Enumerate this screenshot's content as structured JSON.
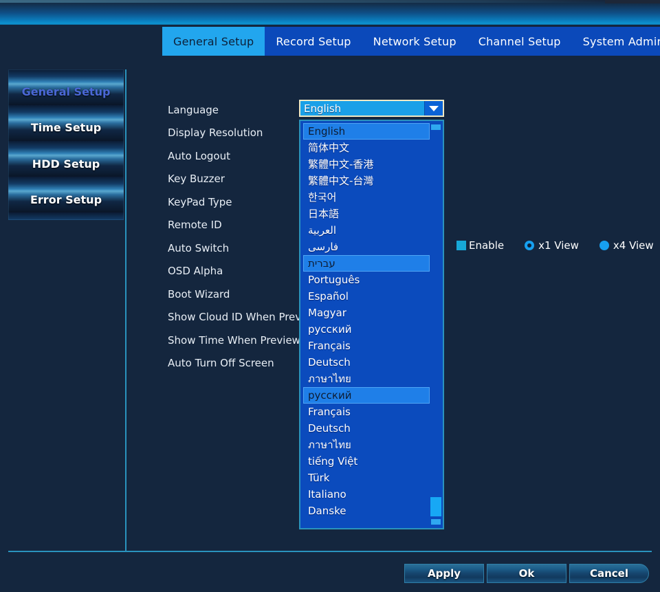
{
  "header": {
    "tabs": [
      {
        "label": "General Setup",
        "active": true
      },
      {
        "label": "Record Setup",
        "active": false
      },
      {
        "label": "Network Setup",
        "active": false
      },
      {
        "label": "Channel Setup",
        "active": false
      },
      {
        "label": "System Admin",
        "active": false
      }
    ]
  },
  "sidebar": {
    "items": [
      {
        "label": "General Setup",
        "selected": true
      },
      {
        "label": "Time Setup",
        "selected": false
      },
      {
        "label": "HDD Setup",
        "selected": false
      },
      {
        "label": "Error Setup",
        "selected": false
      }
    ]
  },
  "form": {
    "rows": [
      {
        "label": "Language"
      },
      {
        "label": "Display Resolution"
      },
      {
        "label": "Auto Logout"
      },
      {
        "label": "Key Buzzer"
      },
      {
        "label": "KeyPad Type"
      },
      {
        "label": "Remote ID"
      },
      {
        "label": "Auto Switch"
      },
      {
        "label": "OSD Alpha"
      },
      {
        "label": "Boot Wizard"
      },
      {
        "label": "Show Cloud ID When Preview"
      },
      {
        "label": "Show Time When Preview"
      },
      {
        "label": "Auto Turn Off Screen"
      }
    ]
  },
  "language_combo": {
    "value": "English",
    "arrow_icon": "chevron-down-icon",
    "expanded": true,
    "options": [
      {
        "label": "English",
        "highlighted": true
      },
      {
        "label": "简体中文",
        "highlighted": false
      },
      {
        "label": "繁體中文-香港",
        "highlighted": false
      },
      {
        "label": "繁體中文-台灣",
        "highlighted": false
      },
      {
        "label": "한국어",
        "highlighted": false
      },
      {
        "label": "日本語",
        "highlighted": false
      },
      {
        "label": "العربية",
        "highlighted": false
      },
      {
        "label": "فارسى",
        "highlighted": false
      },
      {
        "label": "עברית",
        "highlighted": true
      },
      {
        "label": "Português",
        "highlighted": false
      },
      {
        "label": "Español",
        "highlighted": false
      },
      {
        "label": "Magyar",
        "highlighted": false
      },
      {
        "label": "русский",
        "highlighted": false
      },
      {
        "label": "Français",
        "highlighted": false
      },
      {
        "label": "Deutsch",
        "highlighted": false
      },
      {
        "label": "ภาษาไทย",
        "highlighted": false
      },
      {
        "label": "русский",
        "highlighted": true
      },
      {
        "label": "Français",
        "highlighted": false
      },
      {
        "label": "Deutsch",
        "highlighted": false
      },
      {
        "label": "ภาษาไทย",
        "highlighted": false
      },
      {
        "label": "tiếng Việt",
        "highlighted": false
      },
      {
        "label": "Türk",
        "highlighted": false
      },
      {
        "label": "Italiano",
        "highlighted": false
      },
      {
        "label": "Danske",
        "highlighted": false
      }
    ],
    "scrollbar": {
      "up_arrow_icon": "scroll-up-icon",
      "down_arrow_icon": "scroll-down-icon"
    }
  },
  "auto_switch_controls": {
    "enable_label": "Enable",
    "enable_checked": true,
    "view_options": [
      {
        "label": "x1 View",
        "selected": true
      },
      {
        "label": "x4 View",
        "selected": false
      }
    ]
  },
  "footer": {
    "buttons": [
      {
        "label": "Apply"
      },
      {
        "label": "Ok"
      },
      {
        "label": "Cancel"
      }
    ]
  },
  "colors": {
    "background": "#14263e",
    "accent_cyan": "#22a6ee",
    "tab_blue": "#0b49ba",
    "rule_teal": "#2a93bd",
    "combo_border": "#f0e9c4",
    "selected_sidebar_text": "#4a68d6"
  }
}
